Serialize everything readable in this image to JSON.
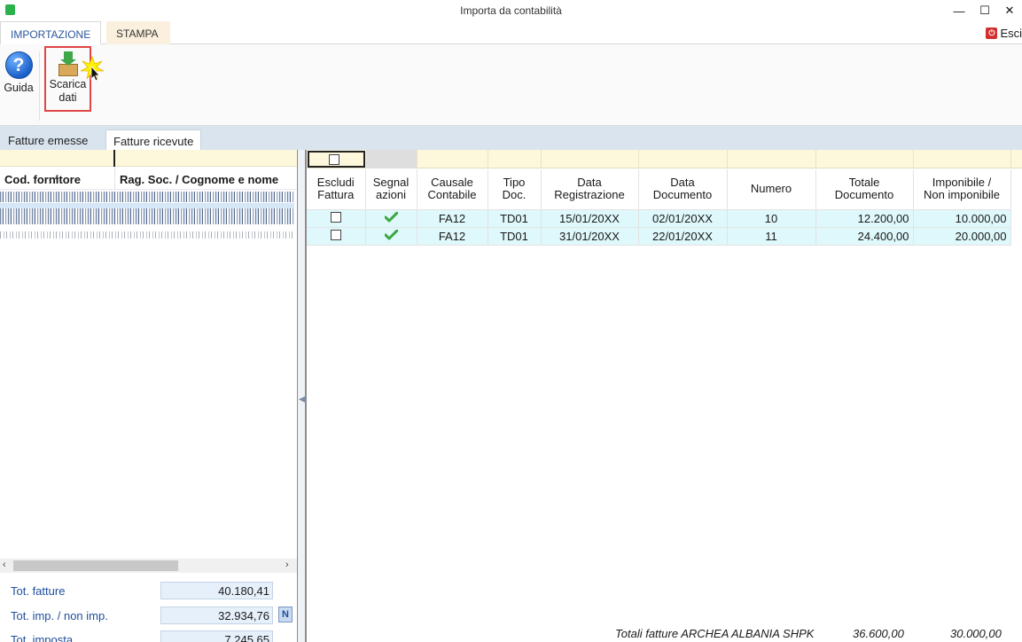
{
  "window": {
    "title": "Importa da contabilità",
    "minimize": "—",
    "maximize": "☐",
    "close": "✕"
  },
  "ribbon": {
    "tabs": [
      "IMPORTAZIONE",
      "STAMPA"
    ],
    "exit_label": "Esci",
    "buttons": {
      "help": {
        "label": "Guida",
        "icon": "help-icon"
      },
      "download": {
        "label_line1": "Scarica",
        "label_line2": "dati",
        "icon": "download-package-icon"
      }
    }
  },
  "content_tabs": [
    "Fatture emesse",
    "Fatture ricevute"
  ],
  "suppliers": {
    "columns": [
      "Cod. fornitore",
      "Rag. Soc. / Cognome e nome"
    ]
  },
  "invoices": {
    "columns": [
      [
        "Escludi",
        "Fattura"
      ],
      [
        "Segnal",
        "azioni"
      ],
      [
        "Causale",
        "Contabile"
      ],
      [
        "Tipo",
        "Doc."
      ],
      [
        "Data",
        "Registrazione"
      ],
      [
        "Data",
        "Documento"
      ],
      [
        "Numero",
        ""
      ],
      [
        "Totale",
        "Documento"
      ],
      [
        "Imponibile /",
        "Non imponibile"
      ]
    ],
    "rows": [
      {
        "causale": "FA12",
        "tipo": "TD01",
        "data_reg": "15/01/20XX",
        "data_doc": "02/01/20XX",
        "numero": "10",
        "totale": "12.200,00",
        "imponibile": "10.000,00"
      },
      {
        "causale": "FA12",
        "tipo": "TD01",
        "data_reg": "31/01/20XX",
        "data_doc": "22/01/20XX",
        "numero": "11",
        "totale": "24.400,00",
        "imponibile": "20.000,00"
      }
    ],
    "footer": {
      "label": "Totali fatture ARCHEA ALBANIA SHPK",
      "totale": "36.600,00",
      "imponibile": "30.000,00"
    }
  },
  "totals": {
    "tot_fatture_label": "Tot. fatture",
    "tot_fatture_value": "40.180,41",
    "tot_imp_label": "Tot. imp. / non imp.",
    "tot_imp_value": "32.934,76",
    "tot_imp_badge": "N",
    "tot_imposta_label": "Tot. imposta",
    "tot_imposta_value": "7.245,65"
  },
  "colors": {
    "accent": "#2b579a",
    "row_highlight": "#dff8fb",
    "filter_row": "#fdf8dc",
    "total_label": "#1f4e9c",
    "highlight_box": "#e04646"
  }
}
